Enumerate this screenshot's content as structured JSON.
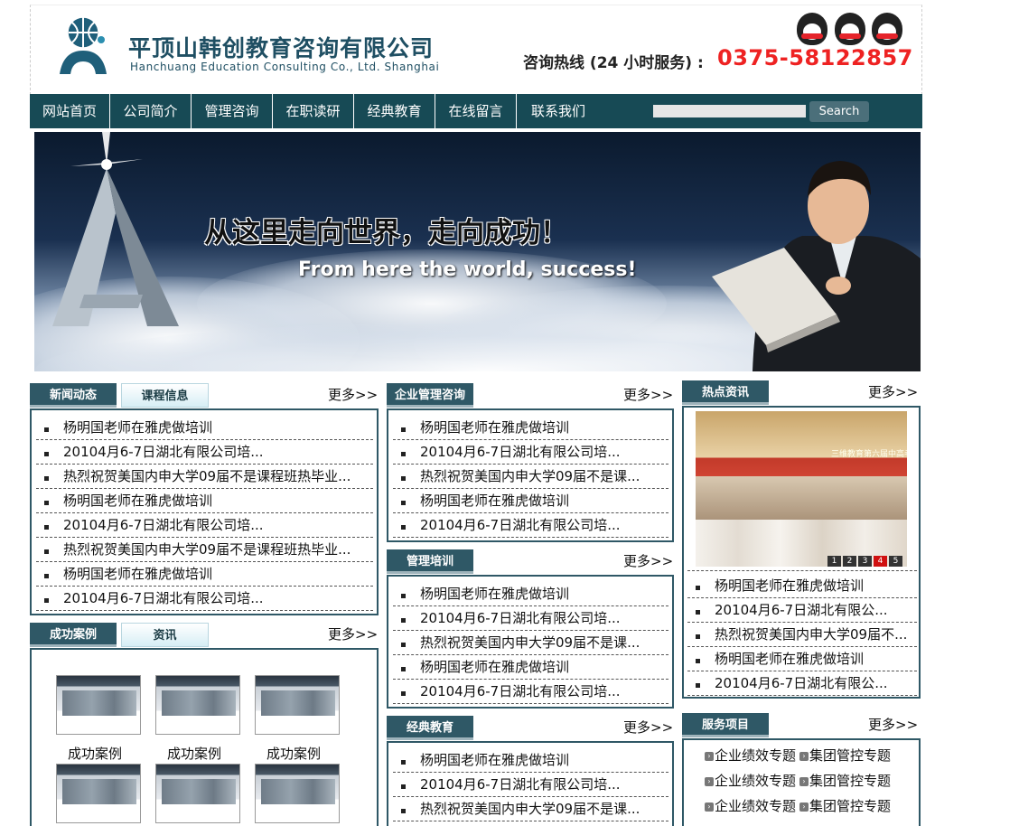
{
  "header": {
    "company_cn": "平顶山韩创教育咨询有限公司",
    "company_en": "Hanchuang Education Consulting Co., Ltd. Shanghai",
    "hotline_label": "咨询热线 (24 小时服务) :",
    "hotline_number": "0375-58122857",
    "qq_icons": [
      "qq-icon",
      "qq-icon",
      "qq-icon"
    ]
  },
  "nav": {
    "items": [
      "网站首页",
      "公司简介",
      "管理咨询",
      "在职读研",
      "经典教育",
      "在线留言",
      "联系我们"
    ],
    "search_button": "Search",
    "search_value": ""
  },
  "banner": {
    "title_cn": "从这里走向世界，走向成功！",
    "title_en": "From here the world, success!"
  },
  "more_label": "更多>>",
  "news": {
    "tab_active": "新闻动态",
    "tab_inactive": "课程信息",
    "items": [
      "杨明国老师在雅虎做培训",
      "20104月6-7日湖北有限公司培...",
      "热烈祝贺美国内申大学09届不是课程班热毕业...",
      "杨明国老师在雅虎做培训",
      "20104月6-7日湖北有限公司培...",
      "热烈祝贺美国内申大学09届不是课程班热毕业...",
      "杨明国老师在雅虎做培训",
      "20104月6-7日湖北有限公司培..."
    ]
  },
  "cases": {
    "tab_active": "成功案例",
    "tab_inactive": "资讯",
    "items": [
      "成功案例",
      "成功案例",
      "成功案例",
      "",
      "",
      ""
    ]
  },
  "consulting": {
    "tab": "企业管理咨询",
    "items": [
      "杨明国老师在雅虎做培训",
      "20104月6-7日湖北有限公司培...",
      "热烈祝贺美国内申大学09届不是课...",
      "杨明国老师在雅虎做培训",
      "20104月6-7日湖北有限公司培..."
    ]
  },
  "training": {
    "tab": "管理培训",
    "items": [
      "杨明国老师在雅虎做培训",
      "20104月6-7日湖北有限公司培...",
      "热烈祝贺美国内申大学09届不是课...",
      "杨明国老师在雅虎做培训",
      "20104月6-7日湖北有限公司培..."
    ]
  },
  "classic": {
    "tab": "经典教育",
    "items": [
      "杨明国老师在雅虎做培训",
      "20104月6-7日湖北有限公司培...",
      "热烈祝贺美国内申大学09届不是课..."
    ]
  },
  "hot": {
    "tab": "热点资讯",
    "slide_indicators": [
      "1",
      "2",
      "3",
      "4",
      "5"
    ],
    "active_slide": "4",
    "photo_banner_text": "三维教育第六届中高考战士",
    "items": [
      "杨明国老师在雅虎做培训",
      "20104月6-7日湖北有限公...",
      "热烈祝贺美国内申大学09届不...",
      "杨明国老师在雅虎做培训",
      "20104月6-7日湖北有限公..."
    ]
  },
  "services": {
    "tab": "服务项目",
    "rows": [
      [
        "企业绩效专题",
        "集团管控专题"
      ],
      [
        "企业绩效专题",
        "集团管控专题"
      ],
      [
        "企业绩效专题",
        "集团管控专题"
      ]
    ]
  },
  "colors": {
    "nav_bg": "#174a55",
    "box_border": "#2f5866",
    "hotline": "#ee2222",
    "brand": "#1f4f63"
  }
}
